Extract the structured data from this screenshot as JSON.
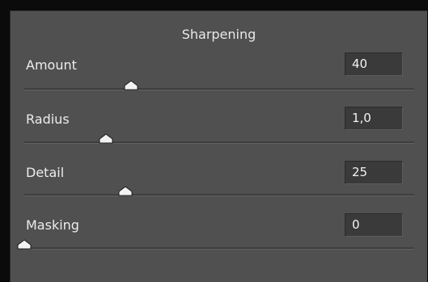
{
  "panel": {
    "title": "Sharpening",
    "sliders": [
      {
        "label": "Amount",
        "value": "40",
        "position": 0.273
      },
      {
        "label": "Radius",
        "value": "1,0",
        "position": 0.209
      },
      {
        "label": "Detail",
        "value": "25",
        "position": 0.259
      },
      {
        "label": "Masking",
        "value": "0",
        "position": 0.0
      }
    ]
  },
  "colors": {
    "panel_bg": "#505050",
    "field_bg": "#3a3a3a",
    "text": "#ececec",
    "thumb": "#f2f2f2"
  },
  "icons": {
    "thumb": "slider-thumb-icon"
  }
}
